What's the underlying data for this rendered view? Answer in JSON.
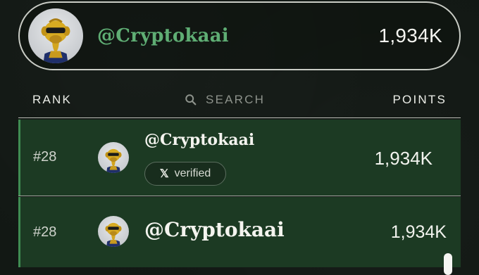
{
  "header": {
    "avatar_icon": "ape-avatar-icon",
    "handle": "@Cryptokaai",
    "points": "1,934K",
    "handle_color": "#5fae74"
  },
  "columns": {
    "rank": "RANK",
    "search": "SEARCH",
    "search_icon": "search-icon",
    "points": "POINTS"
  },
  "rows": [
    {
      "rank": "#28",
      "handle": "@Cryptokaai",
      "badge_icon": "x-logo-icon",
      "badge_label": "verified",
      "points": "1,934K"
    },
    {
      "rank": "#28",
      "handle": "@Cryptokaai",
      "points": "1,934K"
    }
  ],
  "colors": {
    "row_bg": "#1c3a23",
    "row_accent": "#3f8c52",
    "page_bg": "#121814"
  }
}
